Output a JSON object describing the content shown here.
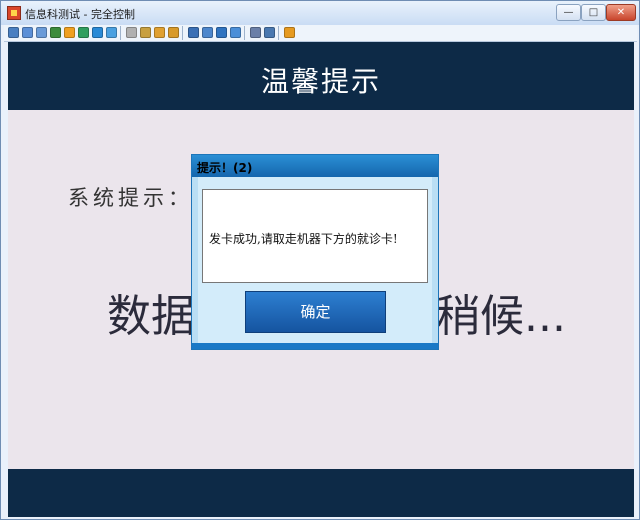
{
  "window": {
    "title": "信息科测试 - 完全控制",
    "min_label": "—",
    "max_label": "□",
    "close_label": "✕"
  },
  "toolbar": {
    "icons": [
      {
        "name": "monitor-icon",
        "color": "#4a7fc1"
      },
      {
        "name": "screen-icon",
        "color": "#5b8fd6"
      },
      {
        "name": "image-icon",
        "color": "#6a9bd8"
      },
      {
        "name": "tool-icon",
        "color": "#3c8c3c"
      },
      {
        "name": "warning-icon",
        "color": "#f0a020"
      },
      {
        "name": "link-icon",
        "color": "#2f9e5f"
      },
      {
        "name": "phone-icon",
        "color": "#2a8ad6"
      },
      {
        "name": "chat-icon",
        "color": "#4aa0e0"
      },
      {
        "name": "lock-icon",
        "color": "#b0b0b0"
      },
      {
        "name": "user-icon",
        "color": "#c8a040"
      },
      {
        "name": "network-icon",
        "color": "#e0a030"
      },
      {
        "name": "settings-icon",
        "color": "#d89a2a"
      },
      {
        "name": "window-icon",
        "color": "#3a6fb5"
      },
      {
        "name": "fullscreen-icon",
        "color": "#4c86cc"
      },
      {
        "name": "display-icon",
        "color": "#2f73c0"
      },
      {
        "name": "tile-icon",
        "color": "#4a8ed8"
      },
      {
        "name": "copy-icon",
        "color": "#6a7fa8"
      },
      {
        "name": "wrench-icon",
        "color": "#4a78b0"
      },
      {
        "name": "exit-icon",
        "color": "#e69a20"
      }
    ]
  },
  "header": {
    "title": "温馨提示"
  },
  "content": {
    "system_label": "系统提示：",
    "loading_left": "数据",
    "loading_right": "稍候..."
  },
  "dialog": {
    "title": "提示！(2)",
    "message": "发卡成功,请取走机器下方的就诊卡!",
    "ok_label": "确定"
  }
}
